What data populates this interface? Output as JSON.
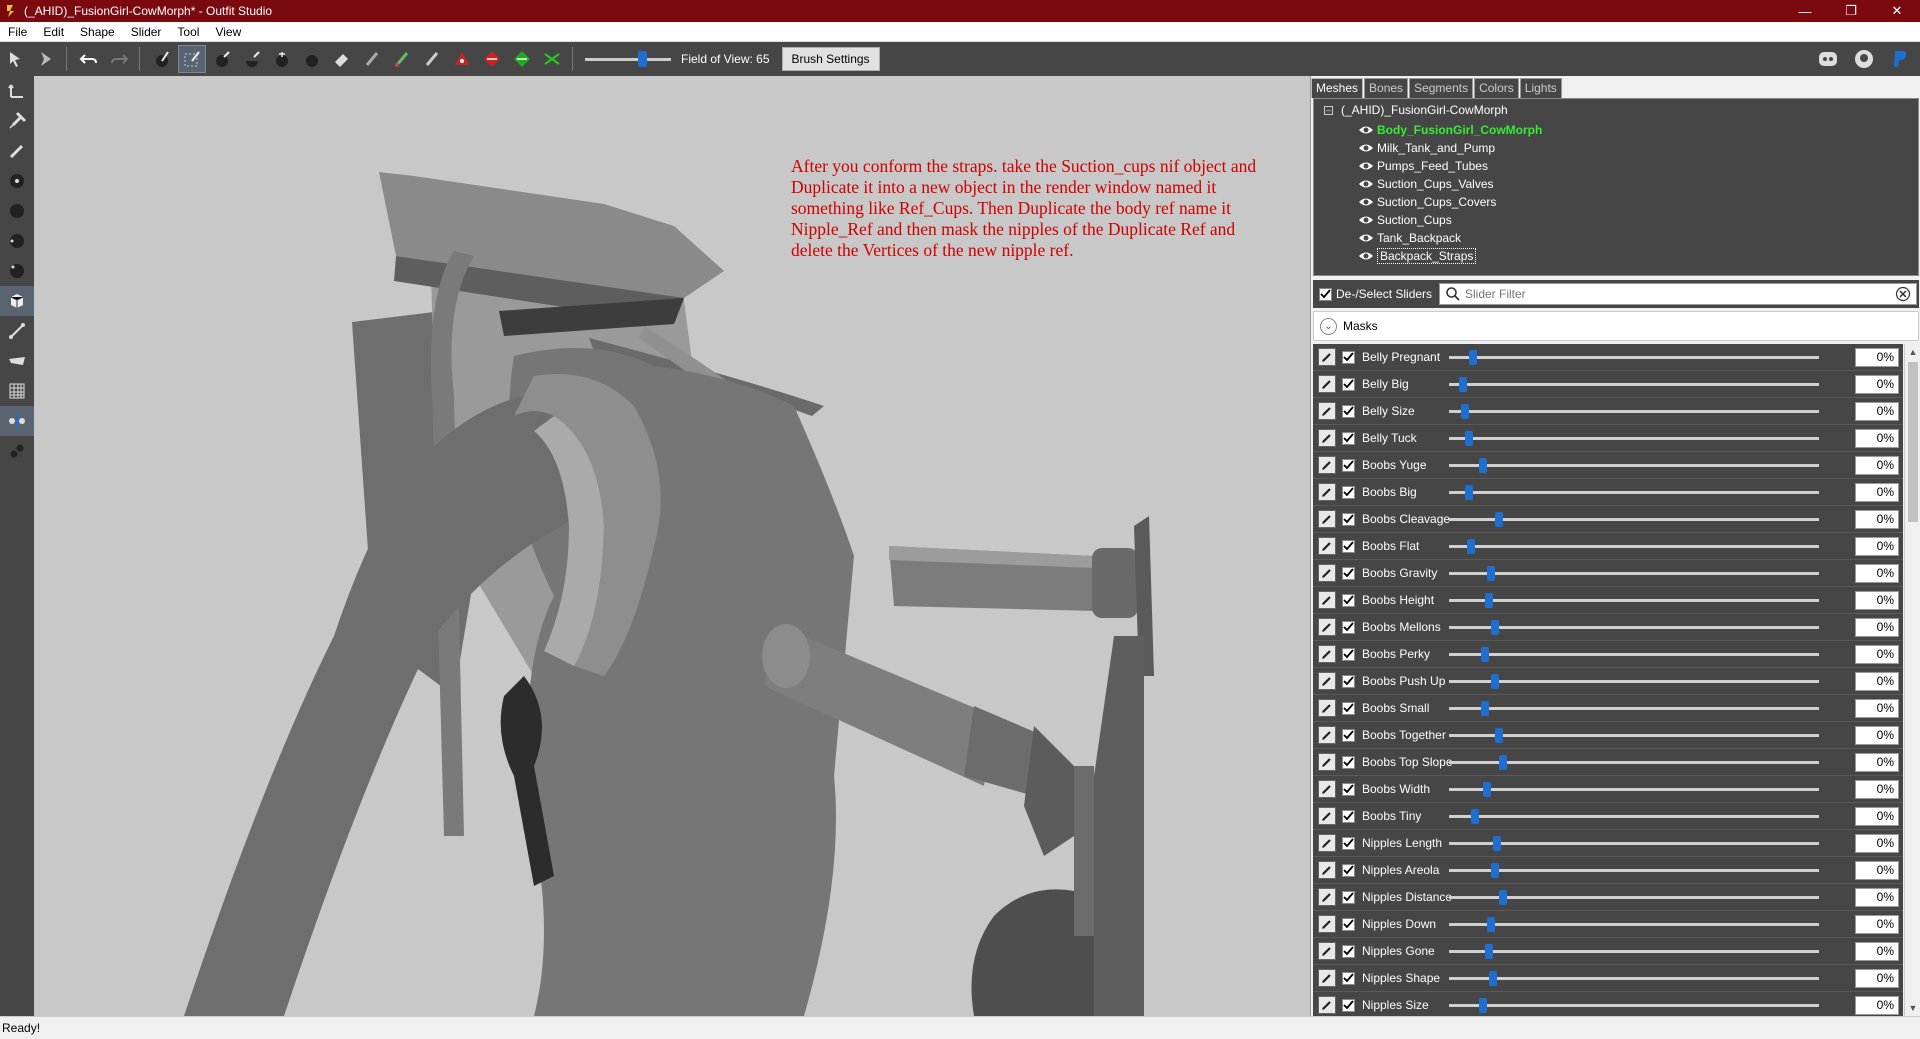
{
  "window": {
    "title": "(_AHID)_FusionGirl-CowMorph* - Outfit Studio",
    "controls": [
      "minimize",
      "restore",
      "close"
    ]
  },
  "menu": [
    "File",
    "Edit",
    "Shape",
    "Slider",
    "Tool",
    "View"
  ],
  "toolbar": {
    "fov_label": "Field of View: 65",
    "fov_value": 65,
    "brush_settings_label": "Brush Settings"
  },
  "viewport": {
    "annotation": "After you conform the straps. take the Suction_cups nif object and Duplicate it into a new object in the render window named it something like Ref_Cups. Then Duplicate the body ref name it Nipple_Ref and then mask the nipples of the Duplicate Ref and delete the Vertices of the new nipple ref."
  },
  "tabs": [
    "Meshes",
    "Bones",
    "Segments",
    "Colors",
    "Lights"
  ],
  "active_tab": "Meshes",
  "mesh_tree": {
    "root": "(_AHID)_FusionGirl-CowMorph",
    "items": [
      {
        "label": "Body_FusionGirl_CowMorph",
        "state": "highlight"
      },
      {
        "label": "Milk_Tank_and_Pump",
        "state": "normal"
      },
      {
        "label": "Pumps_Feed_Tubes",
        "state": "normal"
      },
      {
        "label": "Suction_Cups_Valves",
        "state": "normal"
      },
      {
        "label": "Suction_Cups_Covers",
        "state": "normal"
      },
      {
        "label": "Suction_Cups",
        "state": "normal"
      },
      {
        "label": "Tank_Backpack",
        "state": "normal"
      },
      {
        "label": "Backpack_Straps",
        "state": "selected"
      }
    ]
  },
  "sliders_header": {
    "select_label": "De-/Select Sliders",
    "filter_placeholder": "Slider Filter",
    "masks_label": "Masks"
  },
  "sliders": [
    {
      "name": "Belly Pregnant",
      "value": "0%",
      "level": 0.0
    },
    {
      "name": "Belly Big",
      "value": "0%",
      "level": 0.0
    },
    {
      "name": "Belly Size",
      "value": "0%",
      "level": 0.0
    },
    {
      "name": "Belly Tuck",
      "value": "0%",
      "level": 0.0
    },
    {
      "name": "Boobs Yuge",
      "value": "0%",
      "level": 0.0
    },
    {
      "name": "Boobs Big",
      "value": "0%",
      "level": 0.0
    },
    {
      "name": "Boobs Cleavage",
      "value": "0%",
      "level": 0.0
    },
    {
      "name": "Boobs Flat",
      "value": "0%",
      "level": 0.0
    },
    {
      "name": "Boobs Gravity",
      "value": "0%",
      "level": 0.0
    },
    {
      "name": "Boobs Height",
      "value": "0%",
      "level": 0.0
    },
    {
      "name": "Boobs Mellons",
      "value": "0%",
      "level": 0.0
    },
    {
      "name": "Boobs Perky",
      "value": "0%",
      "level": 0.0
    },
    {
      "name": "Boobs Push Up",
      "value": "0%",
      "level": 0.0
    },
    {
      "name": "Boobs Small",
      "value": "0%",
      "level": 0.0
    },
    {
      "name": "Boobs Together",
      "value": "0%",
      "level": 0.0
    },
    {
      "name": "Boobs Top Slope",
      "value": "0%",
      "level": 0.0
    },
    {
      "name": "Boobs Width",
      "value": "0%",
      "level": 0.0
    },
    {
      "name": "Boobs Tiny",
      "value": "0%",
      "level": 0.0
    },
    {
      "name": "Nipples Length",
      "value": "0%",
      "level": 0.0
    },
    {
      "name": "Nipples Areola",
      "value": "0%",
      "level": 0.0
    },
    {
      "name": "Nipples Distance",
      "value": "0%",
      "level": 0.0
    },
    {
      "name": "Nipples Down",
      "value": "0%",
      "level": 0.0
    },
    {
      "name": "Nipples Gone",
      "value": "0%",
      "level": 0.0
    },
    {
      "name": "Nipples Shape",
      "value": "0%",
      "level": 0.0
    },
    {
      "name": "Nipples Size",
      "value": "0%",
      "level": 0.0
    }
  ],
  "status": "Ready!",
  "colors": {
    "titlebar": "#7a0a10",
    "toolbar": "#464646",
    "viewport": "#c8c8c8",
    "highlight_mesh": "#33ee33",
    "annotation": "#d00000",
    "slider_thumb": "#1e6fd0"
  },
  "icons": {
    "left_tools": [
      "transform-icon",
      "pin-icon",
      "pencil-icon",
      "brush-small-icon",
      "brush-medium-icon",
      "brush-large-icon",
      "brush-xl-icon",
      "box-icon",
      "bone-icon",
      "weight-icon",
      "grid-icon",
      "symmetry-icon",
      "connect-icon"
    ],
    "toolbar": [
      "select-icon",
      "mirror-icon",
      "undo-icon",
      "redo-icon",
      "mask-icon",
      "select-brush-icon",
      "inflate-icon",
      "deflate-icon",
      "move-icon",
      "smooth-icon",
      "erase-icon",
      "weight-brush-icon",
      "color-brush-icon",
      "alpha-brush-icon",
      "anchor-red-icon",
      "anchor-red-diamond-icon",
      "anchor-green-icon",
      "collapse-vertex-icon"
    ],
    "social": [
      "discord-icon",
      "github-icon",
      "paypal-icon"
    ]
  }
}
